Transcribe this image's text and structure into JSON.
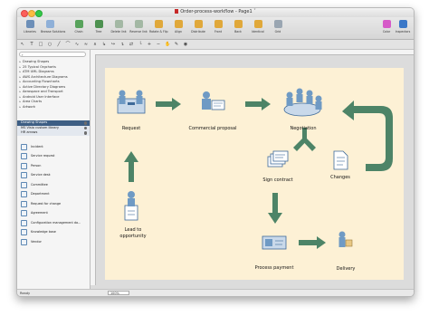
{
  "window": {
    "title": "Order-process-workflow - Page1",
    "title_suffix": "ˇ"
  },
  "toolbar": {
    "left": [
      {
        "name": "libraries",
        "label": "Libraries",
        "icon": "libraries-icon",
        "color": "#6d8fb8"
      },
      {
        "name": "browse-solutions",
        "label": "Browse Solutions",
        "icon": "solutions-icon",
        "color": "#8fb0d8"
      }
    ],
    "middle": [
      {
        "name": "chain",
        "label": "Chain",
        "icon": "chain-icon",
        "color": "#58a35c"
      },
      {
        "name": "tree",
        "label": "Tree",
        "icon": "tree-icon",
        "color": "#4d9150"
      },
      {
        "name": "delete-link",
        "label": "Delete link",
        "icon": "delete-link-icon",
        "color": "#a3b8a4"
      },
      {
        "name": "reverse-link",
        "label": "Reverse link",
        "icon": "reverse-link-icon",
        "color": "#a3b8a4"
      },
      {
        "name": "rotate-flip",
        "label": "Rotate & Flip",
        "icon": "rotate-icon",
        "color": "#e0a83a"
      },
      {
        "name": "align",
        "label": "Align",
        "icon": "align-icon",
        "color": "#e0a83a"
      },
      {
        "name": "distribute",
        "label": "Distribute",
        "icon": "distribute-icon",
        "color": "#e0a83a"
      },
      {
        "name": "front",
        "label": "Front",
        "icon": "front-icon",
        "color": "#e0a83a"
      },
      {
        "name": "back",
        "label": "Back",
        "icon": "back-icon",
        "color": "#e0a83a"
      },
      {
        "name": "identical",
        "label": "Identical",
        "icon": "identical-icon",
        "color": "#e0a83a"
      },
      {
        "name": "grid",
        "label": "Grid",
        "icon": "grid-icon",
        "color": "#9aa6b2"
      }
    ],
    "right": [
      {
        "name": "color",
        "label": "Color",
        "icon": "color-wheel-icon",
        "color": "#d65ac8"
      },
      {
        "name": "inspectors",
        "label": "Inspectors",
        "icon": "inspectors-icon",
        "color": "#3b78c8"
      }
    ]
  },
  "tools": [
    "pointer",
    "text",
    "rect",
    "ellipse",
    "line",
    "arc",
    "curve",
    "bezier",
    "polyline",
    "connector",
    "connector-curve",
    "connector-round",
    "connector-smart",
    "connector-tree",
    "zoom-in",
    "zoom-out",
    "hand",
    "pen",
    "eyedropper"
  ],
  "sidebar": {
    "search_placeholder": "",
    "libraries": [
      "Drawing Shapes",
      "25 Typical Orgcharts",
      "ATM UML Diagrams",
      "AWS Architecture Diagrams",
      "Accounting Flowcharts",
      "Active Directory Diagrams",
      "Aerospace and Transport",
      "Android User Interface",
      "Area Charts",
      "Artwork"
    ],
    "selected_libraries": [
      "Drawing Shapes",
      "MS Visio custom library",
      "HR arrows"
    ],
    "shapes": [
      "Incident",
      "Service request",
      "Person",
      "Service desk",
      "Committee",
      "Department",
      "Request for change",
      "Agreement",
      "Configuration management da...",
      "Knowledge base",
      "Vendor"
    ]
  },
  "diagram": {
    "nodes": {
      "request": "Request",
      "commercial_proposal": "Commercial proposal",
      "negotiation": "Negotiation",
      "sign_contract": "Sign contract",
      "changes": "Changes",
      "lead_to_opportunity": [
        "Lead to",
        "opportunity"
      ],
      "process_payment": "Process payment",
      "delivery": "Delivery"
    },
    "colors": {
      "arrow": "#4d8467",
      "page": "#fdf1d5",
      "figure": "#6f9ac4",
      "figure_dark": "#3e6a99"
    }
  },
  "status": {
    "text": "Ready",
    "zoom": "100%"
  }
}
